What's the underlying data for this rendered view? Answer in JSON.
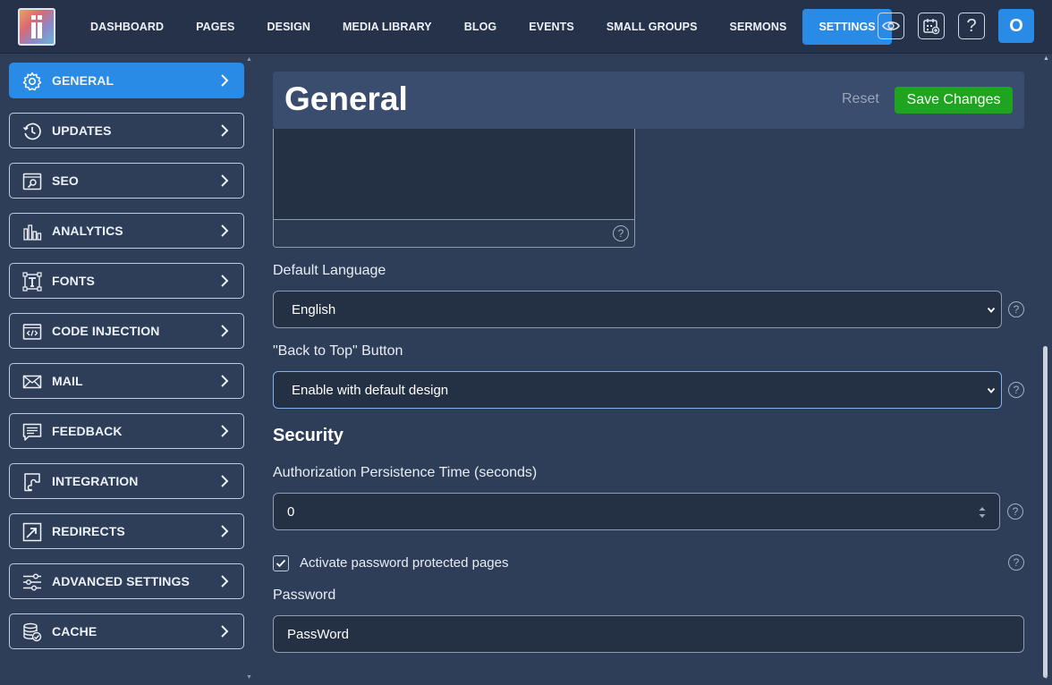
{
  "topbar": {
    "nav": [
      {
        "label": "DASHBOARD"
      },
      {
        "label": "PAGES"
      },
      {
        "label": "DESIGN"
      },
      {
        "label": "MEDIA LIBRARY"
      },
      {
        "label": "BLOG"
      },
      {
        "label": "EVENTS"
      },
      {
        "label": "SMALL GROUPS"
      },
      {
        "label": "SERMONS"
      },
      {
        "label": "SETTINGS",
        "active": true
      }
    ],
    "icons": [
      "eye-icon",
      "calendar-add-icon",
      "help-icon"
    ],
    "help_glyph": "?",
    "avatar_initial": "O"
  },
  "sidebar": {
    "items": [
      {
        "label": "GENERAL",
        "icon": "gear-icon",
        "active": true
      },
      {
        "label": "UPDATES",
        "icon": "history-icon"
      },
      {
        "label": "SEO",
        "icon": "seo-search-icon"
      },
      {
        "label": "ANALYTICS",
        "icon": "bar-chart-icon"
      },
      {
        "label": "FONTS",
        "icon": "font-icon"
      },
      {
        "label": "CODE INJECTION",
        "icon": "code-icon"
      },
      {
        "label": "MAIL",
        "icon": "mail-icon"
      },
      {
        "label": "FEEDBACK",
        "icon": "feedback-icon"
      },
      {
        "label": "INTEGRATION",
        "icon": "integration-icon"
      },
      {
        "label": "REDIRECTS",
        "icon": "redirect-icon"
      },
      {
        "label": "ADVANCED SETTINGS",
        "icon": "sliders-icon"
      },
      {
        "label": "CACHE",
        "icon": "database-icon"
      }
    ]
  },
  "header": {
    "title": "General",
    "reset_label": "Reset",
    "save_label": "Save Changes"
  },
  "form": {
    "default_language": {
      "label": "Default Language",
      "value": "English"
    },
    "back_to_top": {
      "label": "\"Back to Top\" Button",
      "value": "Enable with default design"
    },
    "security_title": "Security",
    "auth_persistence": {
      "label": "Authorization Persistence Time (seconds)",
      "value": "0"
    },
    "password_protected": {
      "label": "Activate password protected pages",
      "checked": true
    },
    "password": {
      "label": "Password",
      "value": "PassWord"
    },
    "help_glyph": "?"
  },
  "colors": {
    "accent": "#2a8be6",
    "save": "#1ea41e",
    "background": "#2e3d58",
    "topbar": "#25324a"
  }
}
